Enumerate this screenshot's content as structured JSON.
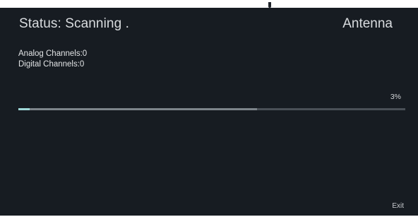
{
  "header": {
    "status": "Status: Scanning .",
    "source": "Antenna"
  },
  "channels": {
    "analog": "Analog Channels:0",
    "digital": "Digital Channels:0"
  },
  "progress": {
    "percent_text": "3%",
    "value": 0.03
  },
  "footer": {
    "exit_label": "Exit"
  },
  "colors": {
    "background": "#171c22",
    "progress_fill": "#9fd8d8",
    "progress_track": "#4a5057"
  }
}
